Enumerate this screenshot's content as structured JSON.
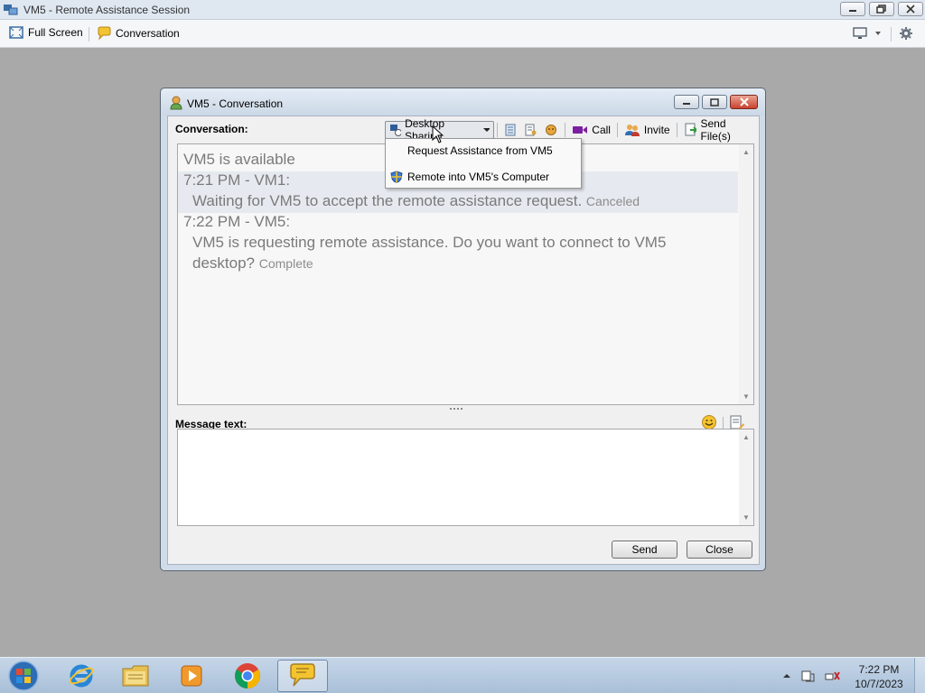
{
  "window": {
    "title": "VM5 - Remote Assistance Session"
  },
  "toolbar": {
    "full_screen": "Full Screen",
    "conversation": "Conversation"
  },
  "dialog": {
    "title": "VM5 - Conversation",
    "conversation_label": "Conversation:",
    "toolbar": {
      "desktop_sharing": "Desktop Sharing",
      "call": "Call",
      "invite": "Invite",
      "send_files": "Send File(s)"
    },
    "menu": {
      "items": [
        {
          "label": "Request Assistance from VM5"
        },
        {
          "label": "Remote into VM5's Computer"
        }
      ]
    },
    "messages": {
      "availability": "VM5 is available",
      "m1_header": "7:21 PM - VM1:",
      "m1_text": "Waiting for VM5 to accept the remote assistance request.",
      "m1_status": "Canceled",
      "m2_header": "7:22 PM - VM5:",
      "m2_text_line1": "VM5 is requesting remote assistance. Do you want to connect to VM5",
      "m2_text_line2": "desktop?",
      "m2_status": "Complete"
    },
    "message_label": "Message text:",
    "message_value": "",
    "send": "Send",
    "close": "Close"
  },
  "taskbar": {
    "time": "7:22 PM",
    "date": "10/7/2023",
    "apps": [
      "Start",
      "Internet Explorer",
      "Windows Explorer",
      "Windows Media Player",
      "Google Chrome",
      "Remote Assistance"
    ]
  },
  "colors": {
    "desktop_bg": "#a9a9a9",
    "dialog_frame": "#cfdbe8",
    "conversation_text": "#7a7a7a",
    "call_icon": "#7b1fa2",
    "close_button": "#c8412e"
  }
}
